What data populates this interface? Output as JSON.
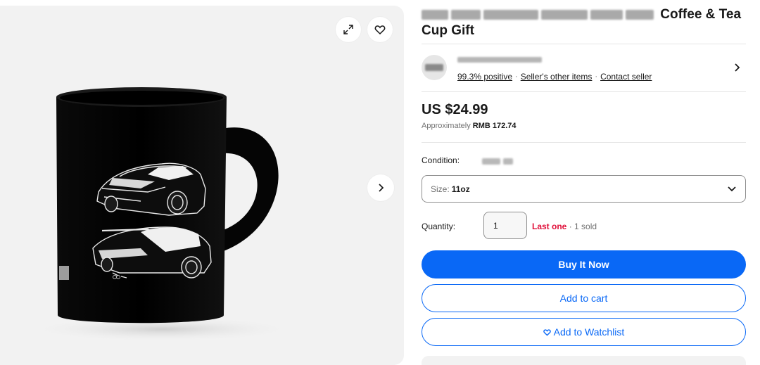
{
  "gallery": {
    "expand_icon": "expand-arrows-icon",
    "favorite_icon": "heart-outline-icon",
    "next_icon": "chevron-right-icon",
    "image": "black-coffee-mug-with-car-sketch"
  },
  "title": {
    "visible_text": "Coffee & Tea",
    "line2": "Cup Gift"
  },
  "seller": {
    "feedback": "99.3% positive",
    "other_items": "Seller's other items",
    "contact": "Contact seller",
    "separator": "·"
  },
  "price": {
    "main": "US $24.99",
    "approx_prefix": "Approximately",
    "approx_value": "RMB 172.74"
  },
  "condition": {
    "label": "Condition:"
  },
  "size": {
    "label": "Size:",
    "value": "11oz"
  },
  "quantity": {
    "label": "Quantity:",
    "value": "1",
    "last_one": "Last one",
    "separator": "·",
    "sold": "1 sold"
  },
  "actions": {
    "buy_now": "Buy It Now",
    "add_to_cart": "Add to cart",
    "add_to_watchlist": "Add to Watchlist"
  },
  "colors": {
    "accent_blue": "#0968f6",
    "urgent_red": "#e0103a",
    "panel_gray": "#f2f2f2"
  }
}
